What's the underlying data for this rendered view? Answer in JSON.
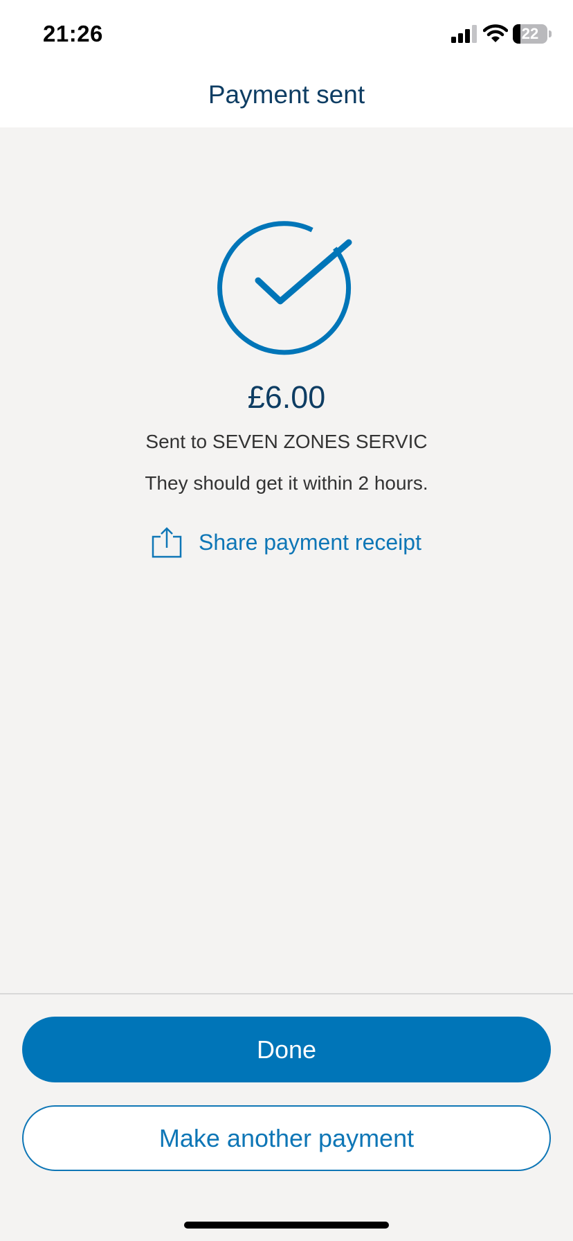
{
  "status_bar": {
    "time": "21:26",
    "battery_level": "22",
    "battery_fraction": 0.22,
    "icons": [
      "signal-icon",
      "wifi-icon",
      "battery-icon"
    ]
  },
  "header": {
    "title": "Payment sent"
  },
  "confirmation": {
    "icon": "checkmark-circle-icon",
    "amount": "£6.00",
    "recipient_text": "Sent to SEVEN ZONES SERVIC",
    "eta_text": "They should get it within 2 hours.",
    "share": {
      "icon": "share-icon",
      "label": "Share payment receipt"
    }
  },
  "actions": {
    "done_label": "Done",
    "another_payment_label": "Make another payment"
  },
  "colors": {
    "brand_blue": "#0075b8",
    "link_blue": "#0e76b6",
    "title_navy": "#0e3d63",
    "background": "#f4f3f2"
  }
}
